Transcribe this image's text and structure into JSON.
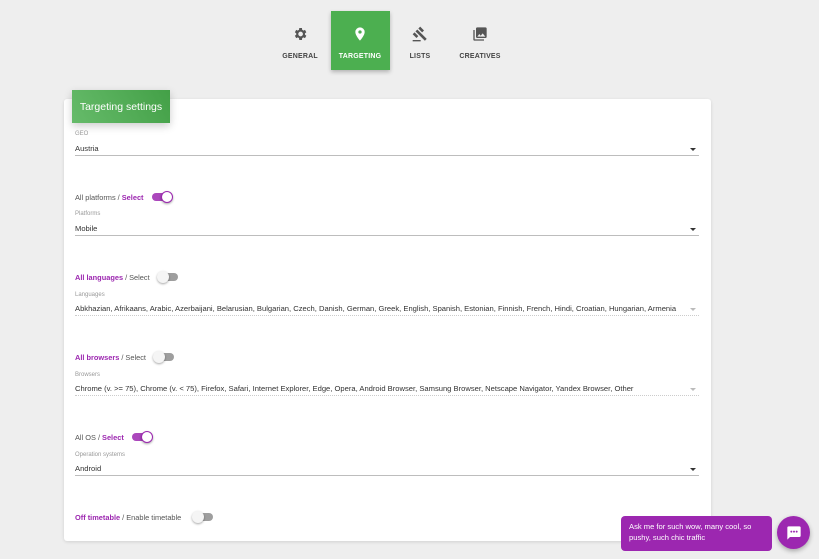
{
  "tabs": [
    {
      "label": "GENERAL",
      "icon": "gear-icon",
      "active": false
    },
    {
      "label": "TARGETING",
      "icon": "location-pin-icon",
      "active": true
    },
    {
      "label": "LISTS",
      "icon": "gavel-icon",
      "active": false
    },
    {
      "label": "CREATIVES",
      "icon": "image-library-icon",
      "active": false
    }
  ],
  "card": {
    "title": "Targeting settings"
  },
  "geo": {
    "label": "GEO",
    "value": "Austria"
  },
  "platforms": {
    "toggle_all": "All platforms",
    "toggle_select": "Select",
    "toggle_checked": true,
    "label": "Platforms",
    "value": "Mobile"
  },
  "languages": {
    "toggle_all": "All languages",
    "toggle_select": "Select",
    "toggle_checked": false,
    "label": "Languages",
    "value": "Abkhazian, Afrikaans, Arabic, Azerbaijani, Belarusian, Bulgarian, Czech, Danish, German, Greek, English, Spanish, Estonian, Finnish, French, Hindi, Croatian, Hungarian, Armenia"
  },
  "browsers": {
    "toggle_all": "All browsers",
    "toggle_select": "Select",
    "toggle_checked": false,
    "label": "Browsers",
    "value": "Chrome (v. >= 75), Chrome (v. < 75), Firefox, Safari, Internet Explorer, Edge, Opera, Android Browser, Samsung Browser, Netscape Navigator, Yandex Browser, Other"
  },
  "os": {
    "toggle_all": "All OS",
    "toggle_select": "Select",
    "toggle_checked": true,
    "label": "Operation systems",
    "value": "Android"
  },
  "timetable": {
    "toggle_off": "Off timetable",
    "toggle_enable": "Enable timetable",
    "toggle_checked": false
  },
  "chat": {
    "message": "Ask me for such wow, many cool, so pushy, such chic traffic",
    "icon": "chat-icon"
  },
  "colors": {
    "accent_green": "#4caf50",
    "accent_purple": "#9c27b0"
  }
}
